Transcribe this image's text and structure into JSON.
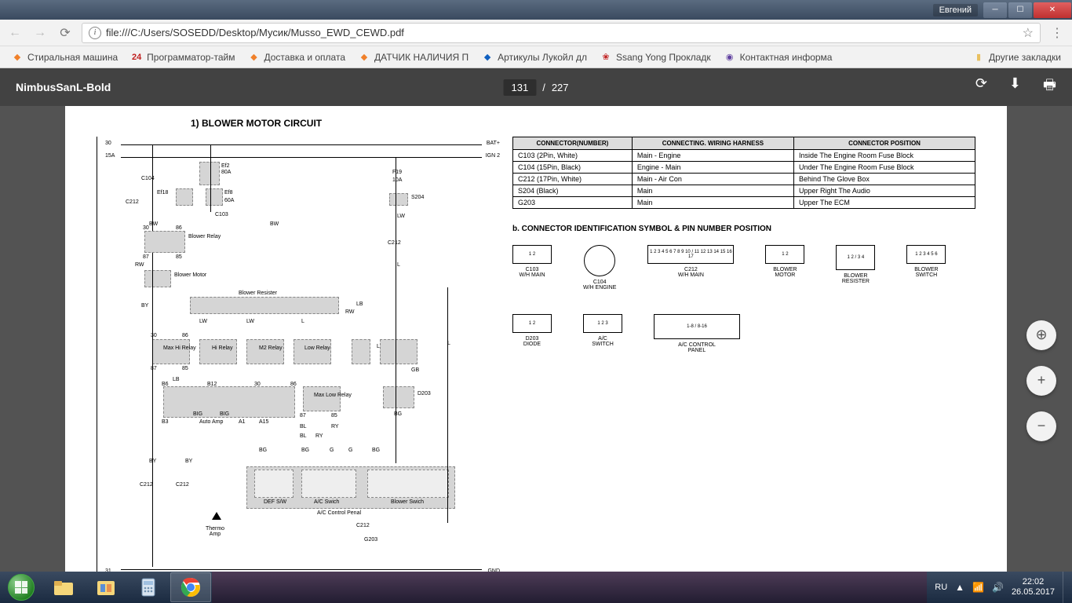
{
  "window": {
    "user": "Евгений"
  },
  "tabs": [
    {
      "title": "NimbusSanL-Bold",
      "active": true
    }
  ],
  "address": "file:///C:/Users/SOSEDD/Desktop/Мусик/Musso_EWD_CEWD.pdf",
  "bookmarks": [
    {
      "label": "Стиральная машина",
      "icon_color": "#f0802a"
    },
    {
      "label": "Программатор-тайм",
      "icon_text": "24",
      "icon_color": "#c02020"
    },
    {
      "label": "Доставка и оплата",
      "icon_color": "#f0802a"
    },
    {
      "label": "ДАТЧИК НАЛИЧИЯ П",
      "icon_color": "#f0802a"
    },
    {
      "label": "Артикулы Лукойл дл",
      "icon_color": "#1060c0"
    },
    {
      "label": "Ssang Yong Прокладк",
      "icon_color": "#c02020"
    },
    {
      "label": "Контактная информа",
      "icon_color": "#6040a0"
    }
  ],
  "bm_other": "Другие закладки",
  "pdf": {
    "title": "NimbusSanL-Bold",
    "current_page": "131",
    "total_pages": "227",
    "section_title": "1)  BLOWER MOTOR CIRCUIT",
    "section_b_title": "b. CONNECTOR IDENTIFICATION SYMBOL & PIN NUMBER POSITION",
    "table_headers": [
      "CONNECTOR(NUMBER)",
      "CONNECTING. WIRING HARNESS",
      "CONNECTOR POSITION"
    ],
    "table_rows": [
      [
        "C103 (2Pin, White)",
        "Main - Engine",
        "Inside The Engine Room Fuse Block"
      ],
      [
        "C104 (15Pin, Black)",
        "Engine - Main",
        "Under The Engine Room Fuse Block"
      ],
      [
        "C212 (17Pin, White)",
        "Main - Air Con",
        "Behind The Glove Box"
      ],
      [
        "S204 (Black)",
        "Main",
        "Upper Right The Audio"
      ],
      [
        "G203",
        "Main",
        "Upper The ECM"
      ]
    ],
    "connectors": [
      {
        "name": "C103",
        "sub": "W/H MAIN",
        "pins": "1 2"
      },
      {
        "name": "C104",
        "sub": "W/H ENGINE",
        "round": true
      },
      {
        "name": "C212",
        "sub": "W/H MAIN",
        "wide": true,
        "pins": "1 2 3 4 5 6 7 8 9 10 / 11 12 13 14 15 16 17"
      },
      {
        "name": "BLOWER",
        "sub": "MOTOR",
        "pins": "1 2"
      },
      {
        "name": "BLOWER",
        "sub": "RESISTER",
        "tall": true,
        "pins": "1 2 / 3 4"
      },
      {
        "name": "BLOWER",
        "sub": "SWITCH",
        "pins": "1 2 3 4 5 6"
      },
      {
        "name": "D203",
        "sub": "DIODE",
        "pins": "1 2"
      },
      {
        "name": "A/C",
        "sub": "SWITCH",
        "pins": "1 2 3"
      },
      {
        "name": "A/C CONTROL",
        "sub": "PANEL",
        "wide": true,
        "tall": true,
        "pins": "1-8 / 8-16"
      }
    ],
    "circuit_labels": {
      "bat": "BAT+",
      "ign": "IGN 2",
      "gnd": "GND",
      "l30": "30",
      "l31": "31",
      "l15a": "15A",
      "blower_relay": "Blower Relay",
      "blower_motor": "Blower Motor",
      "blower_resister": "Blower Resister",
      "auto_amp": "Auto Amp",
      "thermo_amp": "Thermo Amp",
      "ac_control": "A/C Control Penal",
      "ac_switch": "A/C Swich",
      "def_sw": "DEF S/W",
      "blower_switch": "Blower Swich",
      "max_hi": "Max Hi Relay",
      "hi_relay": "Hi Relay",
      "m2_relay": "M2 Relay",
      "low_relay": "Low Relay",
      "max_low": "Max Low Relay",
      "c104": "C104",
      "c103": "C103",
      "c212": "C212",
      "s204": "S204",
      "g203": "G203",
      "f19": "F19",
      "a10": "10A",
      "ef2": "Ef2",
      "a80": "80A",
      "ef18": "Ef18",
      "ef8": "Ef8",
      "a60": "60A",
      "bw": "BW",
      "lw": "LW",
      "rw": "RW",
      "by": "BY",
      "bg": "BG",
      "l": "L",
      "lb": "LB",
      "gb": "GB",
      "b6": "B6",
      "b12": "B12",
      "b3": "B3",
      "a1": "A1",
      "a15": "A15",
      "bl": "BL",
      "ry": "RY",
      "big": "BIG",
      "n30": "30",
      "n86": "86",
      "n87": "87",
      "n85": "85",
      "d203": "D203",
      "g": "G"
    }
  },
  "tray": {
    "lang": "RU",
    "time": "22:02",
    "date": "26.05.2017"
  }
}
